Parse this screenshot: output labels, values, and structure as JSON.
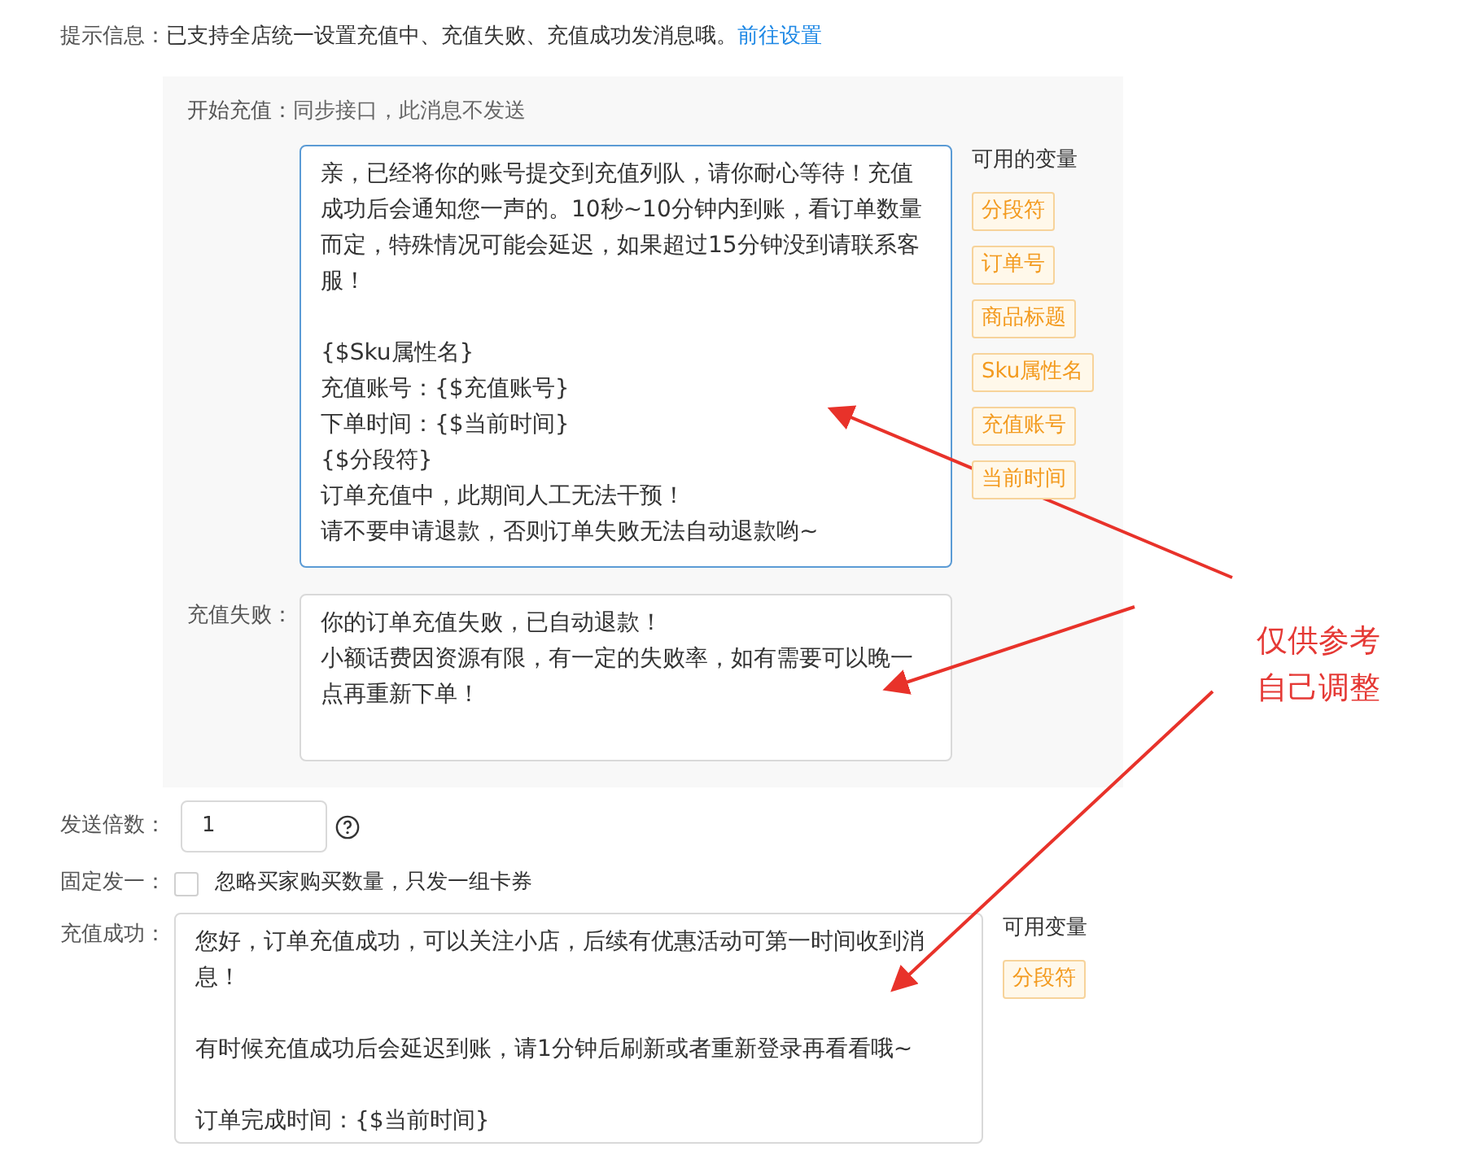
{
  "notice": {
    "label": "提示信息：",
    "text": "已支持全店统一设置充值中、充值失败、充值成功发消息哦。",
    "link": "前往设置"
  },
  "panel": {
    "start": {
      "label": "开始充值：",
      "value": "同步接口，此消息不发送"
    },
    "start_message": [
      [
        "亲，已经将你的账号提交到充值列队，请你耐心等待！充值成功后会通知您一声的。10秒~10分钟内到账，看订单数量而定，特殊情况可能会延迟，如果超过15分钟没到请联系客服！"
      ],
      [
        "{$Sku属性名}",
        "充值账号：{$充值账号}",
        "下单时间：{$当前时间}",
        "{$分段符}",
        "订单充值中，此期间人工无法干预！",
        "请不要申请退款，否则订单失败无法自动退款哟~"
      ]
    ],
    "variables_title": "可用的变量",
    "variables": [
      "分段符",
      "订单号",
      "商品标题",
      "Sku属性名",
      "充值账号",
      "当前时间"
    ],
    "fail": {
      "label": "充值失败：",
      "message": [
        [
          "你的订单充值失败，已自动退款！",
          "小额话费因资源有限，有一定的失败率，如有需要可以晚一点再重新下单！"
        ]
      ]
    }
  },
  "multiplier": {
    "label": "发送倍数：",
    "value": "1"
  },
  "fixed_one": {
    "label": "固定发一：",
    "checked": false,
    "text": "忽略买家购买数量，只发一组卡券"
  },
  "success": {
    "label": "充值成功：",
    "message": [
      [
        "您好，订单充值成功，可以关注小店，后续有优惠活动可第一时间收到消息！"
      ],
      [
        "有时候充值成功后会延迟到账，请1分钟后刷新或者重新登录再看看哦~"
      ],
      [
        "订单完成时间：{$当前时间}"
      ]
    ],
    "variables_title": "可用变量",
    "variables": [
      "分段符"
    ]
  },
  "annotation": [
    "仅供参考",
    "自己调整"
  ]
}
